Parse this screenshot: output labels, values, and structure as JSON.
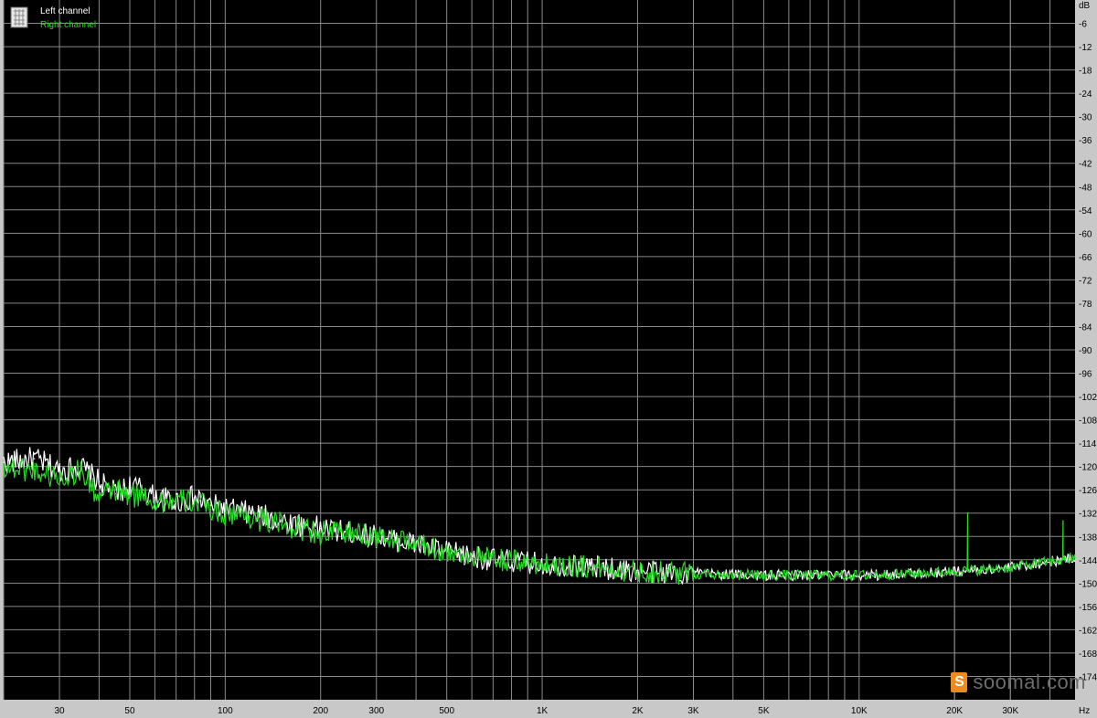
{
  "chart_data": {
    "type": "line",
    "x_scale": "log",
    "x_range_hz": [
      20,
      48000
    ],
    "y_range_db": [
      -180,
      0
    ],
    "x_unit_label": "Hz",
    "y_unit_label": "dB",
    "x_ticks": [
      {
        "value": 30,
        "label": "30"
      },
      {
        "value": 50,
        "label": "50"
      },
      {
        "value": 100,
        "label": "100"
      },
      {
        "value": 200,
        "label": "200"
      },
      {
        "value": 300,
        "label": "300"
      },
      {
        "value": 500,
        "label": "500"
      },
      {
        "value": 1000,
        "label": "1K"
      },
      {
        "value": 2000,
        "label": "2K"
      },
      {
        "value": 3000,
        "label": "3K"
      },
      {
        "value": 5000,
        "label": "5K"
      },
      {
        "value": 10000,
        "label": "10K"
      },
      {
        "value": 20000,
        "label": "20K"
      },
      {
        "value": 30000,
        "label": "30K"
      }
    ],
    "y_ticks": [
      -6,
      -12,
      -18,
      -24,
      -30,
      -36,
      -42,
      -48,
      -54,
      -60,
      -66,
      -72,
      -78,
      -84,
      -90,
      -96,
      -102,
      -108,
      -114,
      -120,
      -126,
      -132,
      -138,
      -144,
      -150,
      -156,
      -162,
      -168,
      -174
    ],
    "grid": true,
    "legend_position": "top-left",
    "series": [
      {
        "name": "Left channel",
        "color": "#ffffff",
        "x": [
          20,
          25,
          30,
          35,
          40,
          45,
          50,
          55,
          60,
          70,
          80,
          90,
          100,
          120,
          150,
          200,
          250,
          300,
          400,
          500,
          700,
          1000,
          1500,
          2000,
          3000,
          5000,
          7000,
          10000,
          15000,
          20000,
          25000,
          30000,
          40000,
          48000
        ],
        "y": [
          -119,
          -118,
          -121,
          -120,
          -124,
          -127,
          -125,
          -126,
          -128,
          -129,
          -128,
          -130,
          -131,
          -132,
          -134,
          -136,
          -137,
          -138,
          -140,
          -142,
          -144,
          -145,
          -146,
          -147,
          -147.5,
          -148,
          -148,
          -148,
          -147.5,
          -147,
          -146.5,
          -146,
          -144.5,
          -143.5
        ]
      },
      {
        "name": "Right channel",
        "color": "#22dd22",
        "x": [
          20,
          25,
          30,
          35,
          40,
          45,
          50,
          55,
          60,
          70,
          80,
          90,
          100,
          120,
          150,
          200,
          250,
          300,
          400,
          500,
          700,
          1000,
          1500,
          2000,
          3000,
          5000,
          7000,
          10000,
          15000,
          20000,
          22000,
          25000,
          30000,
          40000,
          44000,
          48000
        ],
        "y": [
          -120,
          -121,
          -123,
          -121,
          -128,
          -126,
          -128,
          -127,
          -129,
          -129,
          -129,
          -131,
          -132,
          -133,
          -135,
          -137,
          -137,
          -138,
          -140,
          -142,
          -144,
          -145,
          -146,
          -147,
          -147.5,
          -148,
          -148,
          -148,
          -147.5,
          -147,
          -132,
          -146.5,
          -146,
          -144.5,
          -134,
          -143.5
        ]
      }
    ]
  },
  "watermark": {
    "logo_glyph": "S",
    "text": "soomal.com"
  }
}
